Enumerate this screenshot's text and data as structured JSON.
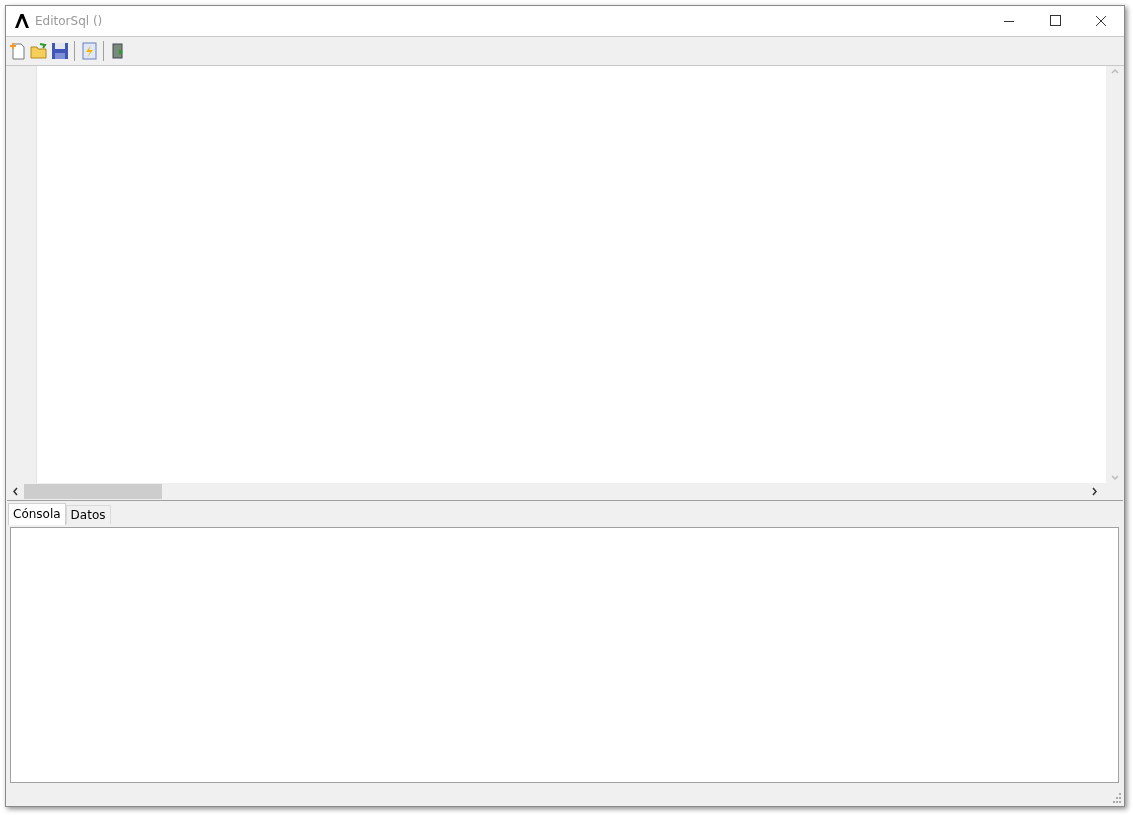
{
  "window": {
    "title": "EditorSql ()"
  },
  "tabs": [
    {
      "label": "Cónsola",
      "selected": true
    },
    {
      "label": "Datos",
      "selected": false
    }
  ]
}
